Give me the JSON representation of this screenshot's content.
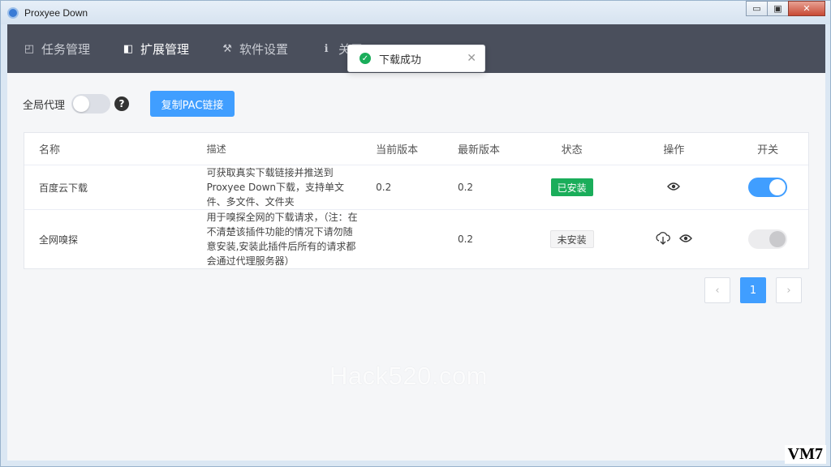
{
  "window": {
    "title": "Proxyee Down",
    "controls": {
      "minimize": "▭",
      "maximize": "▣",
      "close": "✕"
    }
  },
  "nav": {
    "items": [
      {
        "label": "任务管理",
        "icon": "task-icon",
        "glyph": "◰"
      },
      {
        "label": "扩展管理",
        "icon": "extension-icon",
        "glyph": "◧"
      },
      {
        "label": "软件设置",
        "icon": "settings-icon",
        "glyph": "⚒"
      },
      {
        "label": "关于",
        "icon": "info-icon",
        "glyph": "ℹ"
      }
    ],
    "active": "扩展管理"
  },
  "toast": {
    "message": "下载成功",
    "type": "success"
  },
  "proxy": {
    "label": "全局代理",
    "enabled": false,
    "help": "?",
    "pac_button": "复制PAC链接"
  },
  "table": {
    "headers": [
      "名称",
      "描述",
      "当前版本",
      "最新版本",
      "状态",
      "操作",
      "开关"
    ],
    "rows": [
      {
        "name": "百度云下载",
        "description": "可获取真实下载链接并推送到Proxyee Down下载，支持单文件、多文件、文件夹",
        "current_version": "0.2",
        "latest_version": "0.2",
        "status": "已安装",
        "actions": [
          "view-icon"
        ],
        "switch": "on"
      },
      {
        "name": "全网嗅探",
        "description": "用于嗅探全网的下载请求，（注：在不清楚该插件功能的情况下请勿随意安装,安装此插件后所有的请求都会通过代理服务器）",
        "current_version": "",
        "latest_version": "0.2",
        "status": "未安装",
        "actions": [
          "cloud-download-icon",
          "view-icon"
        ],
        "switch": "disabled"
      }
    ]
  },
  "pagination": {
    "prev": "‹",
    "current": "1",
    "next": "›"
  },
  "watermark": "Hack520.com",
  "corner_logo": "VM7",
  "colors": {
    "primary": "#409eff",
    "success": "#1aad5a",
    "nav_bg": "#4a4f5c"
  }
}
